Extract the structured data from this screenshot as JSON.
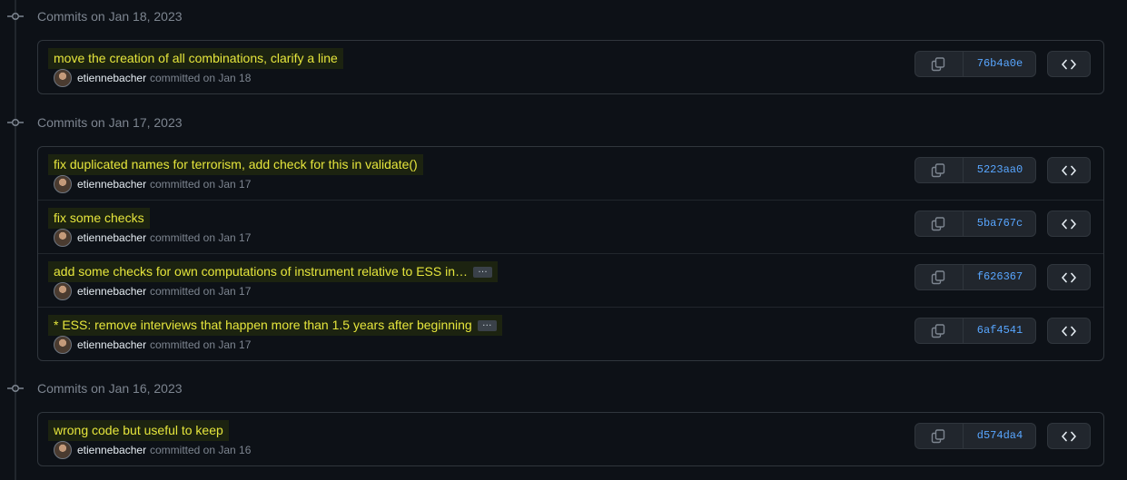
{
  "days": [
    {
      "title": "Commits on Jan 18, 2023",
      "commits": [
        {
          "message": "move the creation of all combinations, clarify a line",
          "has_ellipsis": false,
          "author": "etiennebacher",
          "date_text": "committed on Jan 18",
          "sha": "76b4a0e"
        }
      ]
    },
    {
      "title": "Commits on Jan 17, 2023",
      "commits": [
        {
          "message": "fix duplicated names for terrorism, add check for this in validate()",
          "has_ellipsis": false,
          "author": "etiennebacher",
          "date_text": "committed on Jan 17",
          "sha": "5223aa0"
        },
        {
          "message": "fix some checks",
          "has_ellipsis": false,
          "author": "etiennebacher",
          "date_text": "committed on Jan 17",
          "sha": "5ba767c"
        },
        {
          "message": "add some checks for own computations of instrument relative to ESS in…",
          "has_ellipsis": true,
          "author": "etiennebacher",
          "date_text": "committed on Jan 17",
          "sha": "f626367"
        },
        {
          "message": "* ESS: remove interviews that happen more than 1.5 years after beginning",
          "has_ellipsis": true,
          "author": "etiennebacher",
          "date_text": "committed on Jan 17",
          "sha": "6af4541"
        }
      ]
    },
    {
      "title": "Commits on Jan 16, 2023",
      "commits": [
        {
          "message": "wrong code but useful to keep",
          "has_ellipsis": false,
          "author": "etiennebacher",
          "date_text": "committed on Jan 16",
          "sha": "d574da4"
        }
      ]
    }
  ],
  "ellipsis_label": "…",
  "colors": {
    "background": "#0d1117",
    "border": "#30363d",
    "sha_link": "#58a6ff",
    "highlight_text": "#e6e63c",
    "highlight_bg": "#1c2310",
    "muted_text": "#7d8590"
  },
  "icons": {
    "timeline_node": "git-commit-icon",
    "copy": "copy-icon",
    "browse": "code-icon"
  }
}
